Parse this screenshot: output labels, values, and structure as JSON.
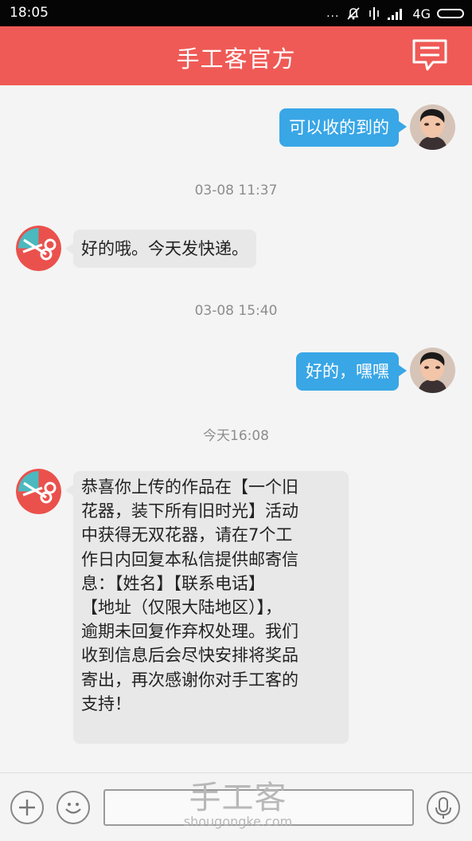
{
  "status_bar": {
    "time": "18:05",
    "dots": "...",
    "network": "4G",
    "icons": [
      "muted-bell-icon",
      "vibrate-icon",
      "signal-icon",
      "battery-icon"
    ]
  },
  "header": {
    "title": "手工客官方",
    "message_icon": "message-icon",
    "background_color": "#ef5a56"
  },
  "chat": {
    "timestamps": [
      "03-08 11:37",
      "03-08 15:40",
      "今天16:08"
    ],
    "messages": [
      {
        "direction": "outgoing",
        "text": "可以收的到的"
      },
      {
        "direction": "incoming",
        "text": "好的哦。今天发快递。"
      },
      {
        "direction": "outgoing",
        "text": "好的，嘿嘿"
      },
      {
        "direction": "incoming",
        "lines": [
          "恭喜你上传的作品在【一个旧",
          "花器，装下所有旧时光】活动",
          "中获得无双花器，请在7个工",
          "作日内回复本私信提供邮寄信",
          "息：【姓名】【联系电话】",
          "【地址（仅限大陆地区）】，",
          "逾期未回复作弃权处理。我们",
          "收到信息后会尽快安排将奖品",
          "寄出，再次感谢你对手工客的",
          "支持！"
        ]
      }
    ]
  },
  "input_bar": {
    "plus_icon": "plus-icon",
    "emoji_icon": "smile-icon",
    "voice_icon": "microphone-icon",
    "text_value": ""
  },
  "watermark": {
    "main": "手工客",
    "url": "shougongke.com"
  },
  "colors": {
    "outgoing_bubble": "#39a6e6",
    "incoming_bubble": "#e8e8e8",
    "background": "#f4f4f4"
  }
}
